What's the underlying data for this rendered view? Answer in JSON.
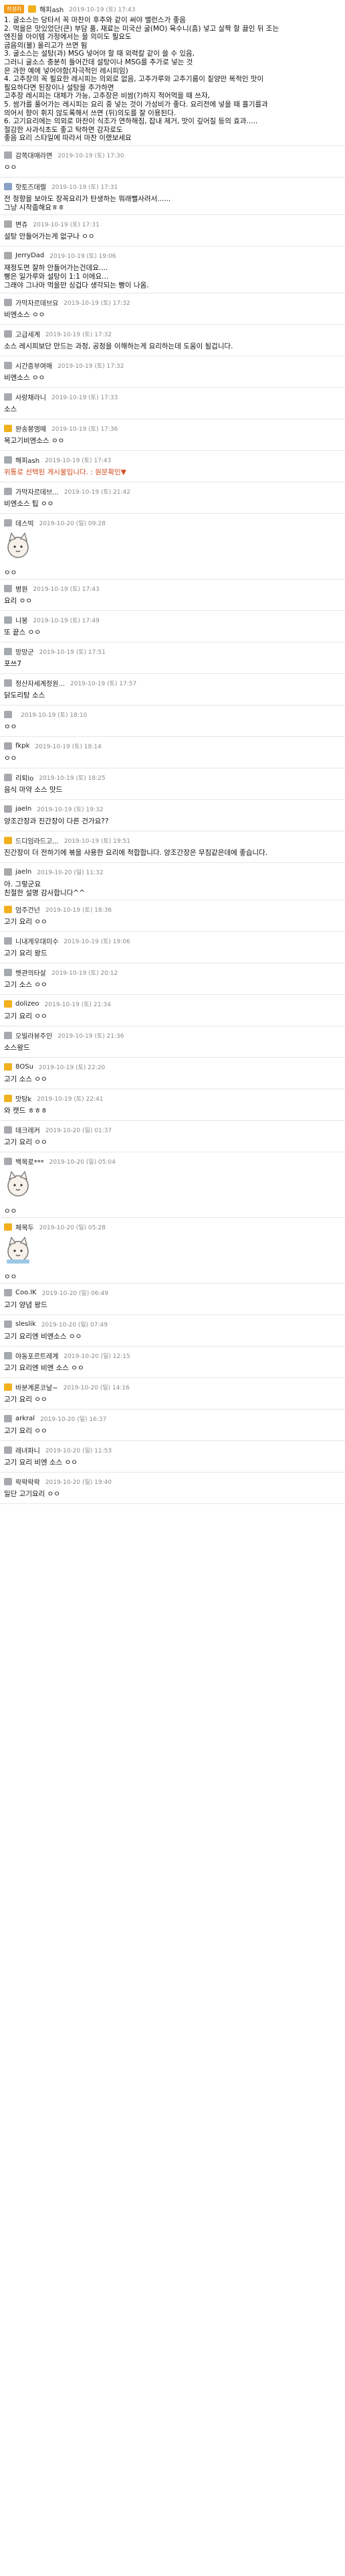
{
  "comments": [
    {
      "badge": "작성자",
      "icon": "o",
      "nick": "해피ash",
      "date": "2019-10-19 (토) 17:43",
      "sticky": true,
      "lines": [
        "1. 굴소스는 당타서 꼭 마찬이 후추와 같이 써야 밸런스가 좋음",
        "2. 먹을은 맛있었단(큰) 부담 품, 재료는 미국산 굴(MO) 육수니(흠) 넣고 살짝 할 끓인 뒤 조는",
        "   엔진을 아이템 가정에서는 을 의미도 필요도",
        "굽음의(물) 올리고가 쓰면 됨",
        "3. 굴소스는 설탕(과) MSG 넣어야 할 때 외력칼 같이 쓸 수 있음,",
        "   그러니 굴소스 충분히 들어간데 설탕이나 MSG를 추가로 넣는 것",
        "   은 과한 예에 넣어야함(자극적인 레시피임)",
        "4. 고추장의 꼭 필요한 레시피는 의외로 없음, 고추가루와 고추기름이 짙양만 목적인 맛이",
        "   필요하다면 된장이나 설탕을 추가하면",
        "고추장 레시피는 대체가 가능, 고추장은 비쌈(?)하지 적어먹을 때 쓰자,",
        "5. 쌈가를 풀어가는 레시피는 요리 중 넣는 것이 가성비가 좋다. 요리전에 넣을 때 흘기를과",
        "   의어서 향이 휘지 않도록해서 쓰면 (뒤)의도를 잘 이용된다.",
        "6. 고기요리에는 의외로 마찬이 식조가 연하해짐, 잡내 제거, 맛이 깊어질 등의 효과.....",
        "   절감한 사과식초도 좋고 탁하면 감자로도",
        "좋음 요리 스타일에 따라서 마찬 이랬보세요"
      ]
    },
    {
      "icon": "g",
      "nick": "감쪽대매라면",
      "date": "2019-10-19 (토) 17:30",
      "lines": [
        "ㅇㅇ"
      ]
    },
    {
      "icon": "b",
      "nick": "핫토즈데렐",
      "date": "2019-10-19 (토) 17:31",
      "lines": [
        "전 정향을 보아도 장꼭요리가 탄생하는 뭐래뻘사려서......",
        "그냥 시작줍해요ㅎㅎ"
      ]
    },
    {
      "icon": "g",
      "nick": "변쥬",
      "date": "2019-10-19 (토) 17:31",
      "lines": [
        "설탕 안들어가는게 없구나 ㅇㅇ"
      ]
    },
    {
      "icon": "g",
      "nick": "JerryDad",
      "date": "2019-10-19 (토) 19:06",
      "lines": [
        "재정도면 잘하 안들어가는건데요....",
        "빵은 일가루와 설탕이 1:1 이에요...",
        "그래야 그나마 먹을만 싱겁다 생각되는 빵이 나옴."
      ]
    },
    {
      "icon": "g",
      "nick": "가막자르데브요",
      "date": "2019-10-19 (토) 17:32",
      "lines": [
        "비엔소스 ㅇㅇ"
      ]
    },
    {
      "icon": "g",
      "nick": "고급세계",
      "date": "2019-10-19 (토) 17:32",
      "lines": [
        "소스 레시피보단 만드는 과정, 공정을 이해하는게 요리하는데 도움이 될겁니다."
      ]
    },
    {
      "icon": "g",
      "nick": "시간증부여매",
      "date": "2019-10-19 (토) 17:32",
      "lines": [
        "비엔소스 ㅇㅇ"
      ]
    },
    {
      "icon": "g",
      "nick": "사랑채라니",
      "date": "2019-10-19 (토) 17:33",
      "lines": [
        "소스"
      ]
    },
    {
      "icon": "o",
      "nick": "완송봉엠떼",
      "date": "2019-10-19 (토) 17:36",
      "lines": [
        "목고기비엔소스 ㅇㅇ"
      ]
    },
    {
      "icon": "g",
      "nick": "해피ash",
      "date": "2019-10-19 (토) 17:43",
      "red": true,
      "lines": [
        "위통로 선택된 게시물입니다. : 원문확인▼"
      ]
    },
    {
      "icon": "g",
      "nick": "가막자르데브...",
      "date": "2019-10-19 (토) 21:42",
      "lines": [
        "비엔소스 팁 ㅇㅇ"
      ]
    },
    {
      "icon": "g",
      "nick": "데스빅",
      "date": "2019-10-20 (일) 09:28",
      "sticker": "cat",
      "lines": [
        "ㅇㅇ"
      ]
    },
    {
      "icon": "g",
      "nick": "병원",
      "date": "2019-10-19 (토) 17:43",
      "lines": [
        "요리 ㅇㅇ"
      ]
    },
    {
      "icon": "g",
      "nick": "니봉",
      "date": "2019-10-19 (토) 17:49",
      "lines": [
        "또 끝스 ㅇㅇ"
      ]
    },
    {
      "icon": "g",
      "nick": "망망군",
      "date": "2019-10-19 (토) 17:51",
      "lines": [
        "포쓰7"
      ]
    },
    {
      "icon": "g",
      "nick": "정산자세계정원...",
      "date": "2019-10-19 (토) 17:57",
      "lines": [
        "닭도리탕 소스"
      ]
    },
    {
      "icon": "g",
      "nick": "",
      "date": "2019-10-19 (토) 18:10",
      "lines": [
        "ㅇㅇ"
      ]
    },
    {
      "icon": "g",
      "nick": "fkpk",
      "date": "2019-10-19 (토) 18:14",
      "lines": [
        "ㅇㅇ"
      ]
    },
    {
      "icon": "g",
      "nick": "리퇴lo",
      "date": "2019-10-19 (토) 18:25",
      "lines": [
        "음식 마약 소스 맛드"
      ]
    },
    {
      "icon": "g",
      "nick": "jaeln",
      "date": "2019-10-19 (토) 19:32",
      "lines": [
        "양조간장과 진간장이 다른 건가요??"
      ]
    },
    {
      "icon": "o",
      "nick": "드디임라드고...",
      "date": "2019-10-19 (토) 19:51",
      "lines": [
        "진간장이 더 전하기에 볶을 사용한 요리에 적합합니다. 양조간장은 무침같은데에 좋습니다."
      ]
    },
    {
      "icon": "g",
      "nick": "jaeln",
      "date": "2019-10-20 (일) 11:32",
      "lines": [
        "아. 그렇군요",
        "친절한 설명 감사합니다^^"
      ]
    },
    {
      "icon": "o",
      "nick": "엄주건넌",
      "date": "2019-10-19 (토) 18:36",
      "lines": [
        "고기 요리 ㅇㅇ"
      ]
    },
    {
      "icon": "g",
      "nick": "니내게우대미수",
      "date": "2019-10-19 (토) 19:06",
      "lines": [
        "고기 요리 왕드"
      ]
    },
    {
      "icon": "g",
      "nick": "벳관의타살",
      "date": "2019-10-19 (토) 20:12",
      "lines": [
        "고기 소스 ㅇㅇ"
      ]
    },
    {
      "icon": "o",
      "nick": "dolizeo",
      "date": "2019-10-19 (토) 21:34",
      "lines": [
        "고기 요리 ㅇㅇ"
      ]
    },
    {
      "icon": "g",
      "nick": "오빌라뷰주인",
      "date": "2019-10-19 (토) 21:36",
      "lines": [
        "소스왕드"
      ]
    },
    {
      "icon": "o",
      "nick": "8OSu",
      "date": "2019-10-19 (토) 22:20",
      "lines": [
        "고기 소스 ㅇㅇ"
      ]
    },
    {
      "icon": "o",
      "nick": "맛탕k",
      "date": "2019-10-19 (토) 22:41",
      "lines": [
        "와 캣드 ㅎㅎㅎ"
      ]
    },
    {
      "icon": "g",
      "nick": "데크레커",
      "date": "2019-10-20 (일) 01:37",
      "lines": [
        "고기 요리 ㅇㅇ"
      ]
    },
    {
      "icon": "g",
      "nick": "백목로***",
      "date": "2019-10-20 (일) 05:04",
      "sticker": "cat",
      "lines": [
        "ㅇㅇ"
      ]
    },
    {
      "icon": "o",
      "nick": "체목두",
      "date": "2019-10-20 (일) 05:28",
      "sticker": "cat2",
      "lines": [
        "ㅇㅇ"
      ]
    },
    {
      "icon": "g",
      "nick": "Coo.IK",
      "date": "2019-10-20 (일) 06:49",
      "lines": [
        "고기 양념 왕드"
      ]
    },
    {
      "icon": "g",
      "nick": "sleslik",
      "date": "2019-10-20 (일) 07:49",
      "lines": [
        "고기 요리엔 비엔소스 ㅇㅇ"
      ]
    },
    {
      "icon": "g",
      "nick": "야동포르트레계",
      "date": "2019-10-20 (일) 12:15",
      "lines": [
        "고기 요리엔 비엔 소스 ㅇㅇ"
      ]
    },
    {
      "icon": "o",
      "nick": "바분계론코날~",
      "date": "2019-10-20 (일) 14:16",
      "lines": [
        "고기 요리 ㅇㅇ"
      ]
    },
    {
      "icon": "g",
      "nick": "arkral",
      "date": "2019-10-20 (일) 16:37",
      "lines": [
        "고기 요리 ㅇㅇ"
      ]
    },
    {
      "icon": "g",
      "nick": "레녀파니",
      "date": "2019-10-20 (일) 11:53",
      "lines": [
        "고기 요리 비엔 소스 ㅇㅇ"
      ]
    },
    {
      "icon": "g",
      "nick": "락락락락",
      "date": "2019-10-20 (일) 19:40",
      "lines": [
        "일단 고기요리 ㅇㅇ"
      ]
    }
  ]
}
